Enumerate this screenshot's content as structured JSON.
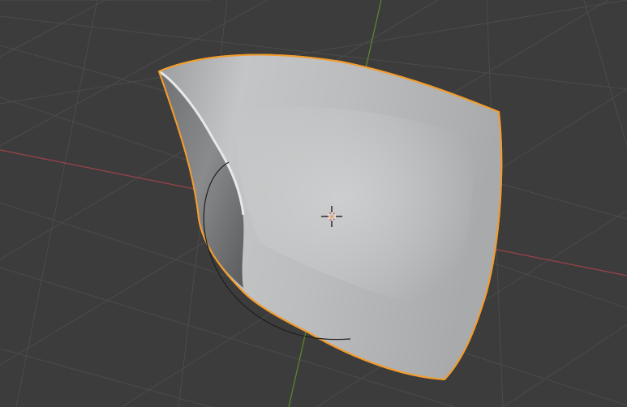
{
  "app": "3D Viewport",
  "viewport": {
    "background_color": "#3c3c3c",
    "grid_color": "#4a4a4a",
    "x_axis_color": "#b14a52",
    "y_axis_color": "#6f9a2d",
    "selection_outline_color": "#f29c2d",
    "surface_color": "#b8b9ba"
  },
  "scene": {
    "active_object": "curved-tube-surface",
    "origin_marker": "3d-cursor-icon",
    "selected": true
  }
}
